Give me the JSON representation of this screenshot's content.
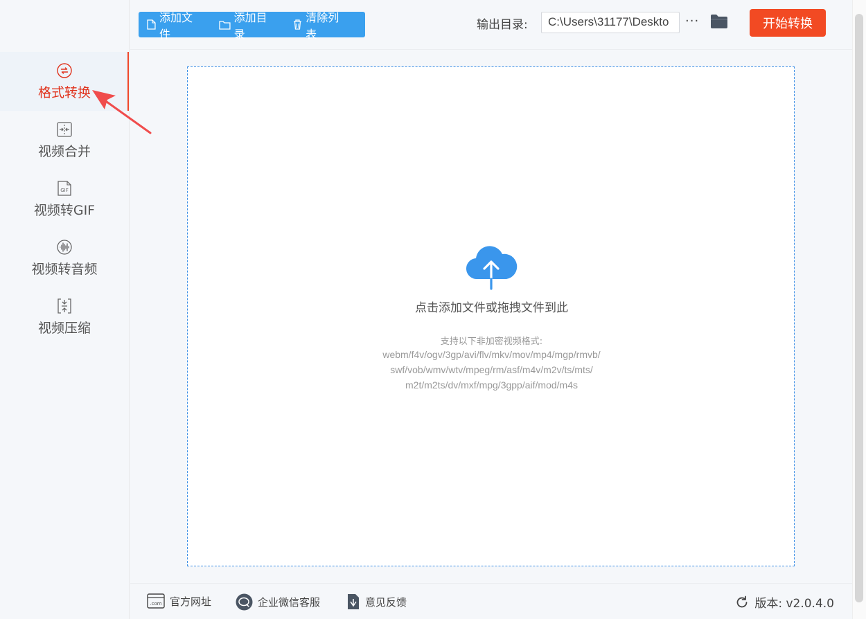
{
  "sidebar": {
    "items": [
      {
        "label": "格式转换",
        "icon": "convert-icon",
        "active": true
      },
      {
        "label": "视频合并",
        "icon": "merge-icon"
      },
      {
        "label": "视频转GIF",
        "icon": "gif-file-icon",
        "icon_text": "GIF"
      },
      {
        "label": "视频转音频",
        "icon": "audio-wave-icon"
      },
      {
        "label": "视频压缩",
        "icon": "compress-icon"
      }
    ]
  },
  "toolbar": {
    "add_file": "添加文件",
    "add_dir": "添加目录",
    "clear_list": "清除列表",
    "output_label": "输出目录:",
    "output_path": "C:\\Users\\31177\\Deskto",
    "more": "···",
    "start": "开始转换"
  },
  "dropzone": {
    "title": "点击添加文件或拖拽文件到此",
    "formats_title": "支持以下非加密视频格式:",
    "formats_lines": [
      "webm/f4v/ogv/3gp/avi/flv/mkv/mov/mp4/mgp/rmvb/",
      "swf/vob/wmv/wtv/mpeg/rm/asf/m4v/m2v/ts/mts/",
      "m2t/m2ts/dv/mxf/mpg/3gpp/aif/mod/m4s"
    ]
  },
  "footer": {
    "website": "官方网址",
    "website_icon_text": ".com",
    "wechat": "企业微信客服",
    "feedback": "意见反馈",
    "version": "版本:  v2.0.4.0"
  },
  "colors": {
    "accent_blue": "#3aa0ee",
    "start_red": "#f24a23",
    "active_red": "#e0331d",
    "annotation_red": "#f04c4c"
  }
}
